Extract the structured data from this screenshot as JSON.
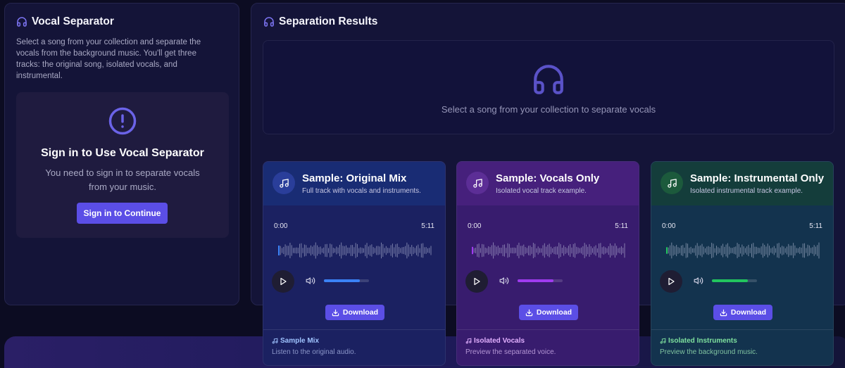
{
  "left_panel": {
    "title": "Vocal Separator",
    "description": "Select a song from your collection and separate the vocals from the background music. You'll get three tracks: the original song, isolated vocals, and instrumental.",
    "signin": {
      "title": "Sign in to Use Vocal Separator",
      "text": "You need to sign in to separate vocals from your music.",
      "button_label": "Sign in to Continue"
    }
  },
  "right_panel": {
    "title": "Separation Results",
    "empty_state": "Select a song from your collection to separate vocals"
  },
  "cards": [
    {
      "title": "Sample: Original Mix",
      "subtitle": "Full track with vocals and instruments.",
      "time_current": "0:00",
      "time_total": "5:11",
      "volume": 0.8,
      "download_label": "Download",
      "footer_title": "Sample Mix",
      "footer_subtitle": "Listen to the original audio.",
      "accent": "#3b82f6"
    },
    {
      "title": "Sample: Vocals Only",
      "subtitle": "Isolated vocal track example.",
      "time_current": "0:00",
      "time_total": "5:11",
      "volume": 0.8,
      "download_label": "Download",
      "footer_title": "Isolated Vocals",
      "footer_subtitle": "Preview the separated voice.",
      "accent": "#a03bf0"
    },
    {
      "title": "Sample: Instrumental Only",
      "subtitle": "Isolated instrumental track example.",
      "time_current": "0:00",
      "time_total": "5:11",
      "volume": 0.8,
      "download_label": "Download",
      "footer_title": "Isolated Instruments",
      "footer_subtitle": "Preview the background music.",
      "accent": "#22c55e"
    }
  ],
  "icons": {
    "panel_title": "headphones-icon",
    "signin": "alert-circle-icon",
    "empty_state": "headphones-icon",
    "card": "music-note-icon",
    "play": "play-icon",
    "volume": "volume-icon",
    "download": "download-icon"
  },
  "colors": {
    "primary_button": "#5b4ee6",
    "icon_accent": "#6b63e8"
  }
}
